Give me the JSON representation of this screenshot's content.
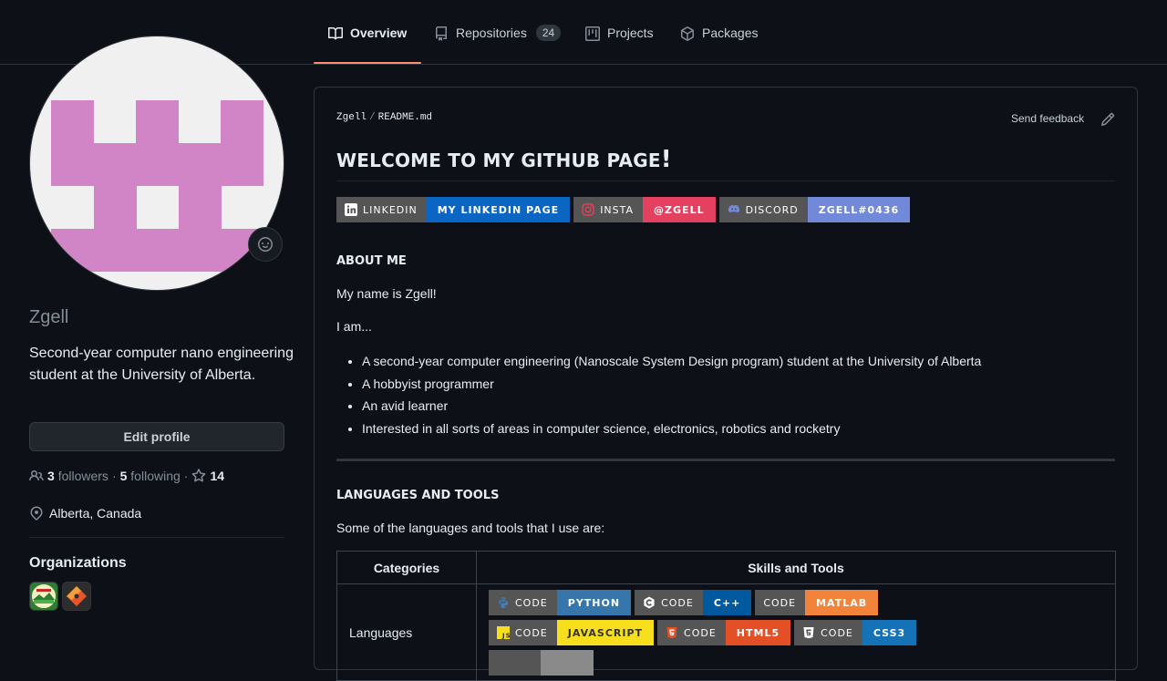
{
  "tabs": [
    {
      "label": "Overview",
      "icon": "book-icon",
      "active": true
    },
    {
      "label": "Repositories",
      "icon": "repo-icon",
      "count": "24"
    },
    {
      "label": "Projects",
      "icon": "project-icon"
    },
    {
      "label": "Packages",
      "icon": "package-icon"
    }
  ],
  "profile": {
    "username": "Zgell",
    "bio": "Second-year computer nano engineering student at the University of Alberta.",
    "edit_label": "Edit profile",
    "followers_count": "3",
    "followers_label": "followers",
    "following_count": "5",
    "following_label": "following",
    "stars_count": "14",
    "dot": "·",
    "location": "Alberta, Canada",
    "orgs_title": "Organizations",
    "avatar_color": "#d285c6"
  },
  "readme": {
    "owner": "Zgell",
    "sep": "/",
    "file": "README.md",
    "feedback": "Send feedback",
    "heading": "WELCOME TO MY GITHUB PAGE",
    "heading_bang": "!",
    "social_badges": [
      {
        "left": "LINKEDIN",
        "right": "MY LINKEDIN PAGE",
        "color": "#0a66c2",
        "icon": "linkedin-icon"
      },
      {
        "left": "INSTA",
        "right": "@ZGELL",
        "color": "#e4405f",
        "icon": "instagram-icon"
      },
      {
        "left": "DISCORD",
        "right": "ZGELL#0436",
        "color": "#7289da",
        "icon": "discord-icon"
      }
    ],
    "about_title": "ABOUT ME",
    "about_p1": "My name is Zgell!",
    "about_p2": "I am...",
    "about_items": [
      "A second-year computer engineering (Nanoscale System Design program) student at the University of Alberta",
      "A hobbyist programmer",
      "An avid learner",
      "Interested in all sorts of areas in computer science, electronics, robotics and rocketry"
    ],
    "lang_title": "LANGUAGES AND TOOLS",
    "lang_intro": "Some of the languages and tools that I use are:",
    "table": {
      "col1": "Categories",
      "col2": "Skills and Tools",
      "row1_cat": "Languages",
      "row1_badges": [
        [
          {
            "left": "CODE",
            "right": "PYTHON",
            "color": "#3776ab",
            "icon": "python-icon"
          },
          {
            "left": "CODE",
            "right": "C++",
            "color": "#00599c",
            "icon": "cpp-icon"
          },
          {
            "left": "CODE",
            "right": "MATLAB",
            "color": "#f2833b",
            "icon": ""
          }
        ],
        [
          {
            "left": "CODE",
            "right": "JAVASCRIPT",
            "color": "#f7df1e",
            "icon": "javascript-icon"
          },
          {
            "left": "CODE",
            "right": "HTML5",
            "color": "#e34f26",
            "icon": "html5-icon"
          },
          {
            "left": "CODE",
            "right": "CSS3",
            "color": "#1572b6",
            "icon": "css3-icon"
          }
        ]
      ]
    }
  }
}
